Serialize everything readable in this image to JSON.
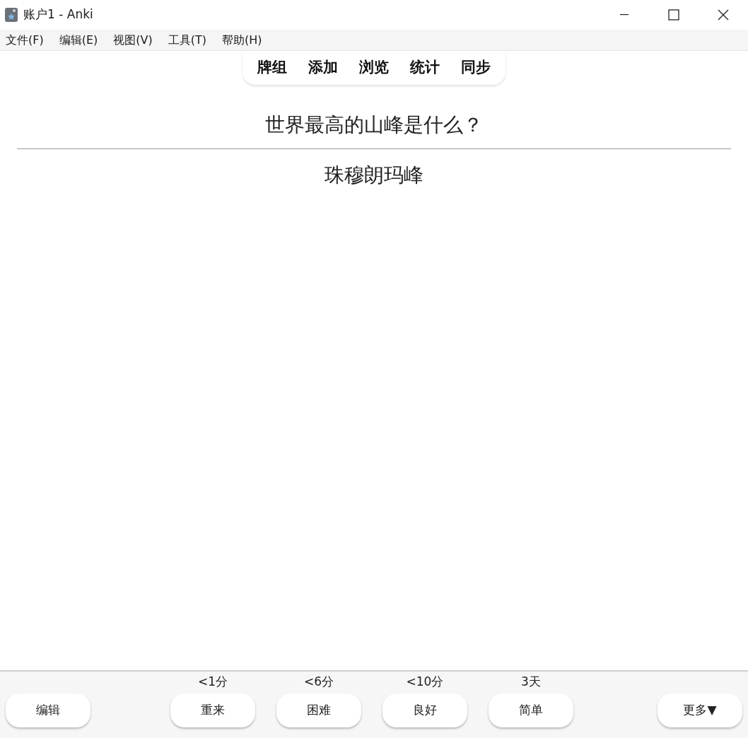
{
  "window": {
    "title": "账户1 - Anki"
  },
  "menu": [
    "文件(F)",
    "编辑(E)",
    "视图(V)",
    "工具(T)",
    "帮助(H)"
  ],
  "toolbar": [
    "牌组",
    "添加",
    "浏览",
    "统计",
    "同步"
  ],
  "card": {
    "question": "世界最高的山峰是什么？",
    "answer": "珠穆朗玛峰"
  },
  "bottom_bar": {
    "edit_button": "编辑",
    "answers": [
      {
        "interval": "<1分",
        "label": "重来"
      },
      {
        "interval": "<6分",
        "label": "困难"
      },
      {
        "interval": "<10分",
        "label": "良好"
      },
      {
        "interval": "3天",
        "label": "简单"
      }
    ],
    "more_button": "更多▼"
  }
}
